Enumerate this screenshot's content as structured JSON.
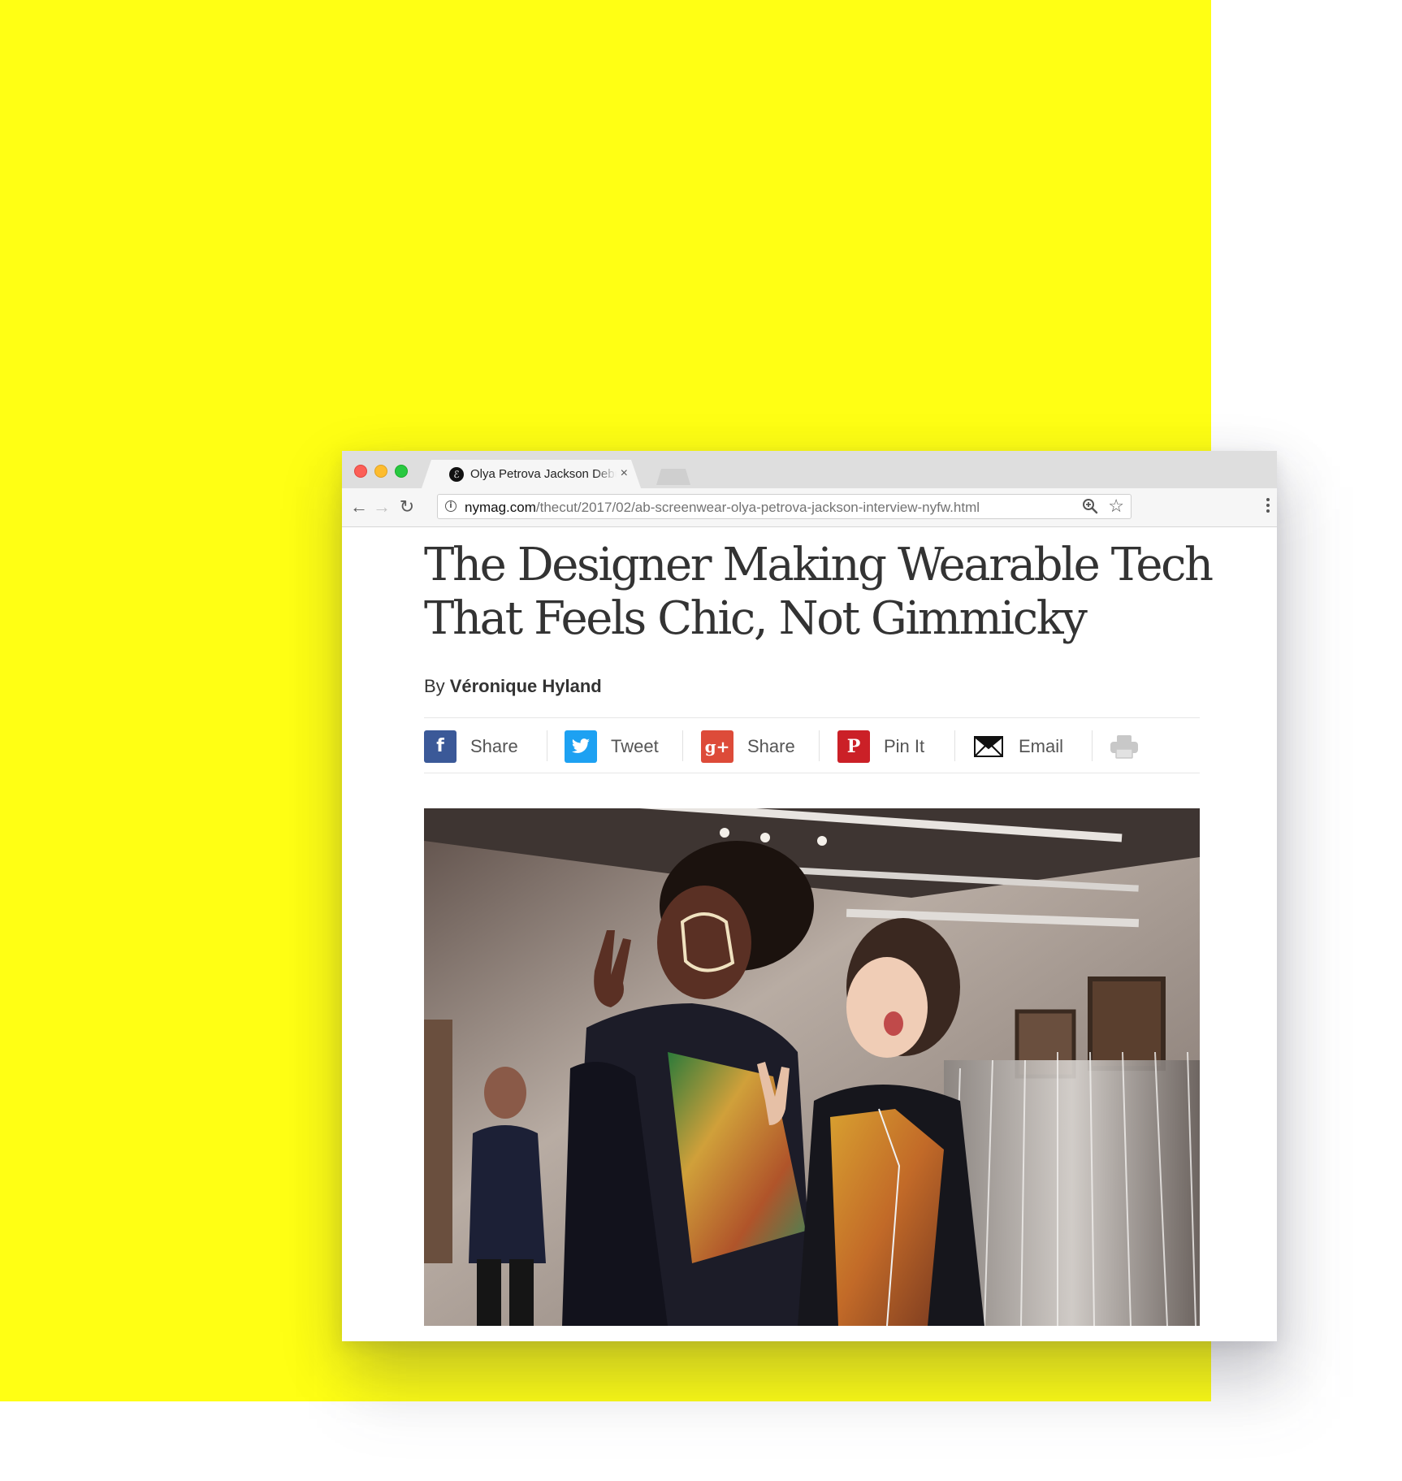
{
  "browser": {
    "tab": {
      "title": "Olya Petrova Jackson Debuts A",
      "close_glyph": "×",
      "favicon_glyph": "ℰ"
    },
    "toolbar": {
      "back_glyph": "←",
      "forward_glyph": "→",
      "reload_glyph": "↻"
    },
    "address_bar": {
      "url_host": "nymag.com",
      "url_path": "/thecut/2017/02/ab-screenwear-olya-petrova-jackson-interview-nyfw.html",
      "star_glyph": "☆"
    }
  },
  "article": {
    "headline": "The Designer Making Wearable Tech That Feels Chic, Not Gimmicky",
    "byline_prefix": "By",
    "byline_author": "Véronique Hyland"
  },
  "share_bar": {
    "items": [
      {
        "label": "Share",
        "icon": "facebook-icon",
        "glyph": "f",
        "color": "#3b5998"
      },
      {
        "label": "Tweet",
        "icon": "twitter-icon",
        "color": "#1da1f2"
      },
      {
        "label": "Share",
        "icon": "google-plus-icon",
        "glyph": "g+",
        "color": "#dd4b39"
      },
      {
        "label": "Pin It",
        "icon": "pinterest-icon",
        "glyph": "P",
        "color": "#cb2027"
      },
      {
        "label": "Email",
        "icon": "envelope-icon",
        "color": "#111111"
      },
      {
        "label": "",
        "icon": "print-icon",
        "color": "#c8c8c8"
      }
    ]
  },
  "colors": {
    "background_accent": "#ffff14"
  }
}
